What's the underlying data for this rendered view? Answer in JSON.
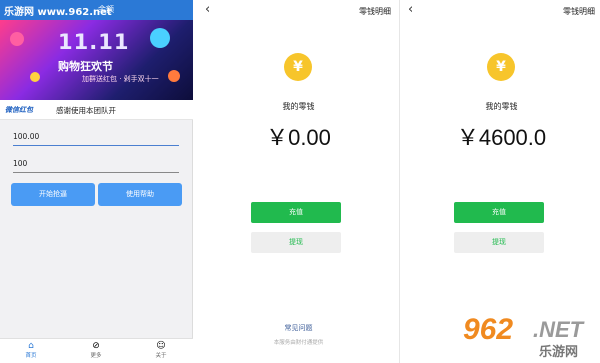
{
  "watermark": {
    "top_text": "乐游网 www.962.net",
    "big_num": "962",
    "big_net": ".NET",
    "big_cn": "乐游网"
  },
  "left_app": {
    "top_title": "余额",
    "banner": {
      "title": "11.11",
      "subtitle": "购物狂欢节",
      "tagline": "加群送红包 · 剁手双十一"
    },
    "ticker": {
      "logo": "微信红包",
      "text": "感谢使用本团队开"
    },
    "field1_value": "100.00",
    "field2_value": "100",
    "start_button": "开始抢逼",
    "help_button": "使用帮助",
    "tabs": [
      {
        "label": "首页",
        "icon": "home-icon"
      },
      {
        "label": "更多",
        "icon": "compass-icon"
      },
      {
        "label": "关于",
        "icon": "face-icon"
      }
    ]
  },
  "wallet1": {
    "title": "零钱明细",
    "coin_symbol": "¥",
    "label": "我的零钱",
    "amount": "￥0.00",
    "recharge": "充值",
    "withdraw": "提现",
    "faq": "常见问题",
    "footnote": "本服务由财付通提供"
  },
  "wallet2": {
    "title": "零钱明细",
    "coin_symbol": "¥",
    "label": "我的零钱",
    "amount": "￥4600.0",
    "recharge": "充值",
    "withdraw": "提现"
  },
  "colors": {
    "accent_blue": "#2b79d6",
    "button_blue": "#4a9bf4",
    "wechat_green": "#21ba4e",
    "coin_yellow": "#f7c52b"
  }
}
